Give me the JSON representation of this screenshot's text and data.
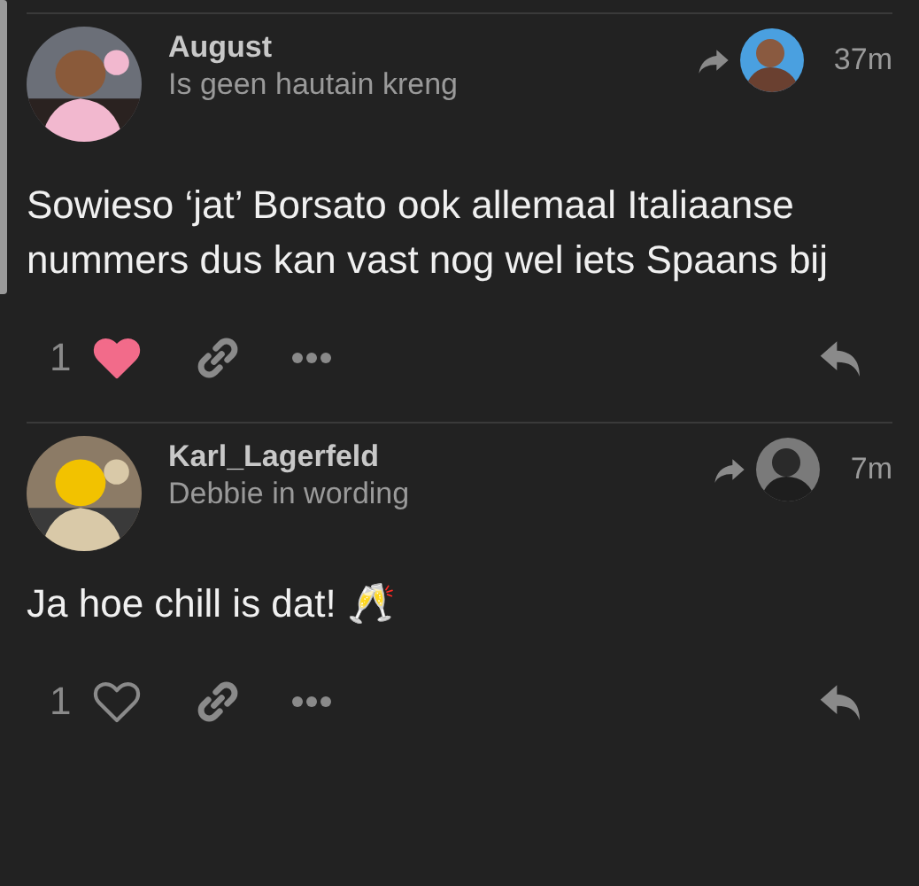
{
  "posts": [
    {
      "username": "August",
      "user_title": "Is geen hautain kreng",
      "time": "37m",
      "body": "Sowieso ‘jat’ Borsato ook allemaal Italiaanse nummers dus kan vast nog wel iets Spaans bij",
      "like_count": "1",
      "liked": true
    },
    {
      "username": "Karl_Lagerfeld",
      "user_title": "Debbie in wording",
      "time": "7m",
      "body": "Ja hoe chill is dat! 🥂",
      "like_count": "1",
      "liked": false
    }
  ]
}
